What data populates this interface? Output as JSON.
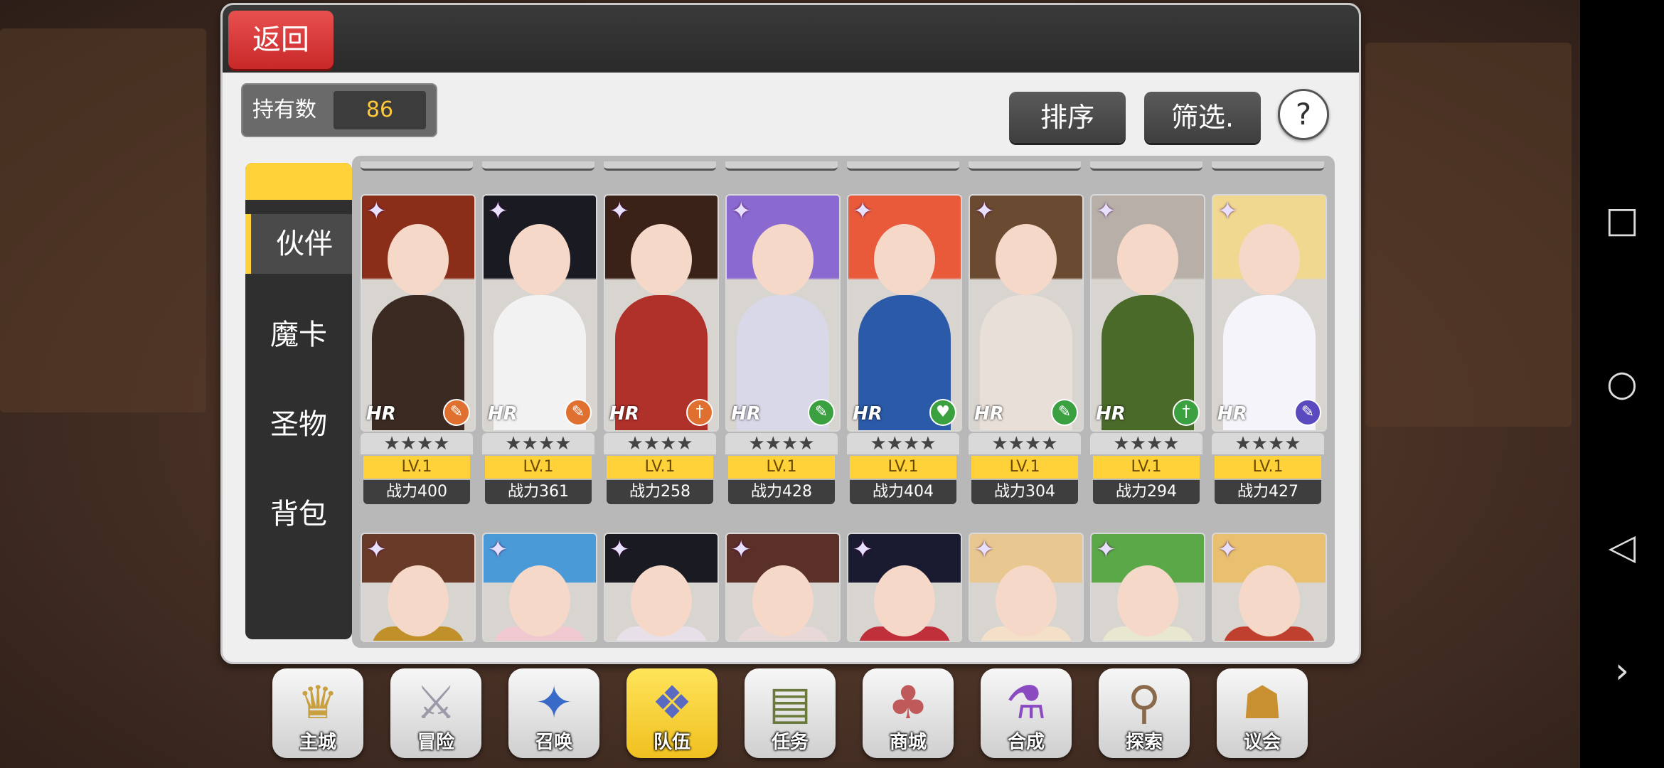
{
  "header": {
    "back_label": "返回"
  },
  "owned": {
    "label": "持有数",
    "value": "86"
  },
  "toolbar": {
    "sort_label": "排序",
    "filter_label": "筛选.",
    "help_label": "?"
  },
  "side_tabs": [
    {
      "label": "伙伴",
      "active": true
    },
    {
      "label": "魔卡"
    },
    {
      "label": "圣物"
    },
    {
      "label": "背包"
    }
  ],
  "characters_row1": [
    {
      "hr": "HR",
      "stars": "★★★★",
      "level": "LV.1",
      "power": "战力400",
      "hair": "#8a2e1a",
      "outfit": "#3a2a22",
      "badge": "#e07030",
      "badge_icon": "✎"
    },
    {
      "hr": "HR",
      "stars": "★★★★",
      "level": "LV.1",
      "power": "战力361",
      "hair": "#1a1a22",
      "outfit": "#f2f2f2",
      "badge": "#e07030",
      "badge_icon": "✎"
    },
    {
      "hr": "HR",
      "stars": "★★★★",
      "level": "LV.1",
      "power": "战力258",
      "hair": "#3a2218",
      "outfit": "#b0302a",
      "badge": "#e07030",
      "badge_icon": "†"
    },
    {
      "hr": "HR",
      "stars": "★★★★",
      "level": "LV.1",
      "power": "战力428",
      "hair": "#8a6ad0",
      "outfit": "#d8d8e8",
      "badge": "#3aa040",
      "badge_icon": "✎"
    },
    {
      "hr": "HR",
      "stars": "★★★★",
      "level": "LV.1",
      "power": "战力404",
      "hair": "#e85a3a",
      "outfit": "#2a5aa8",
      "badge": "#3aa040",
      "badge_icon": "♥"
    },
    {
      "hr": "HR",
      "stars": "★★★★",
      "level": "LV.1",
      "power": "战力304",
      "hair": "#6a4a30",
      "outfit": "#e8e0d8",
      "badge": "#3aa040",
      "badge_icon": "✎"
    },
    {
      "hr": "HR",
      "stars": "★★★★",
      "level": "LV.1",
      "power": "战力294",
      "hair": "#b8b0a8",
      "outfit": "#4a6a2a",
      "badge": "#3aa040",
      "badge_icon": "†"
    },
    {
      "hr": "HR",
      "stars": "★★★★",
      "level": "LV.1",
      "power": "战力427",
      "hair": "#f0d890",
      "outfit": "#f4f4fa",
      "badge": "#5a4ac0",
      "badge_icon": "✎"
    }
  ],
  "characters_row2": [
    {
      "hair": "#6a3a28",
      "outfit": "#c0902a"
    },
    {
      "hair": "#4a9ad8",
      "outfit": "#f0c8d0"
    },
    {
      "hair": "#1a1a22",
      "outfit": "#e8e0e8"
    },
    {
      "hair": "#5a3028",
      "outfit": "#e8d8d8"
    },
    {
      "hair": "#1a1a30",
      "outfit": "#c0303a"
    },
    {
      "hair": "#e8c890",
      "outfit": "#f4e0c8"
    },
    {
      "hair": "#5aa848",
      "outfit": "#e8e8d0"
    },
    {
      "hair": "#e8c070",
      "outfit": "#c04030"
    }
  ],
  "bottom_nav": [
    {
      "label": "主城",
      "icon": "♛",
      "color": "#c8a040"
    },
    {
      "label": "冒险",
      "icon": "⚔",
      "color": "#9a9aa8"
    },
    {
      "label": "召唤",
      "icon": "✦",
      "color": "#3a6ac8"
    },
    {
      "label": "队伍",
      "icon": "❖",
      "color": "#5a6ac0",
      "active": true
    },
    {
      "label": "任务",
      "icon": "▤",
      "color": "#6a7a3a"
    },
    {
      "label": "商城",
      "icon": "♣",
      "color": "#c05a5a"
    },
    {
      "label": "合成",
      "icon": "⚗",
      "color": "#8a4ac0"
    },
    {
      "label": "探索",
      "icon": "⚲",
      "color": "#8a6a4a"
    },
    {
      "label": "议会",
      "icon": "☗",
      "color": "#c89030"
    }
  ],
  "system_nav": {
    "recent": "□",
    "home": "○",
    "back": "◁",
    "more": "›"
  }
}
